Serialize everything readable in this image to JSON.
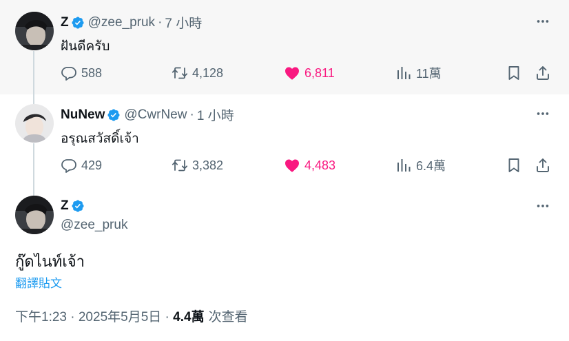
{
  "colors": {
    "verified": "#1d9bf0",
    "like": "#f91880",
    "muted": "#536471",
    "text": "#0f1419",
    "link": "#1d9bf0",
    "highlight_bg": "#f7f7f7"
  },
  "tweets": [
    {
      "name": "Z",
      "handle": "@zee_pruk",
      "dot": "·",
      "time": "7 小時",
      "text": "ฝันดีครับ",
      "replies": "588",
      "retweets": "4,128",
      "likes": "6,811",
      "views": "11萬"
    },
    {
      "name": "NuNew",
      "handle": "@CwrNew",
      "dot": "·",
      "time": "1 小時",
      "text": "อรุณสวัสดิ์เจ้า",
      "replies": "429",
      "retweets": "3,382",
      "likes": "4,483",
      "views": "6.4萬"
    }
  ],
  "main_tweet": {
    "name": "Z",
    "handle": "@zee_pruk",
    "text": "กู๊ดไนท์เจ้า",
    "translate": "翻譯貼文",
    "timestamp": "下午1:23 · 2025年5月5日 · ",
    "views_count": "4.4萬",
    "views_label": "次查看"
  },
  "icons": {
    "verified": "verified-badge-icon",
    "more": "more-dots-icon",
    "reply": "reply-bubble-icon",
    "retweet": "retweet-icon",
    "like": "heart-filled-icon",
    "views": "bar-chart-icon",
    "bookmark": "bookmark-icon",
    "share": "share-upload-icon"
  }
}
